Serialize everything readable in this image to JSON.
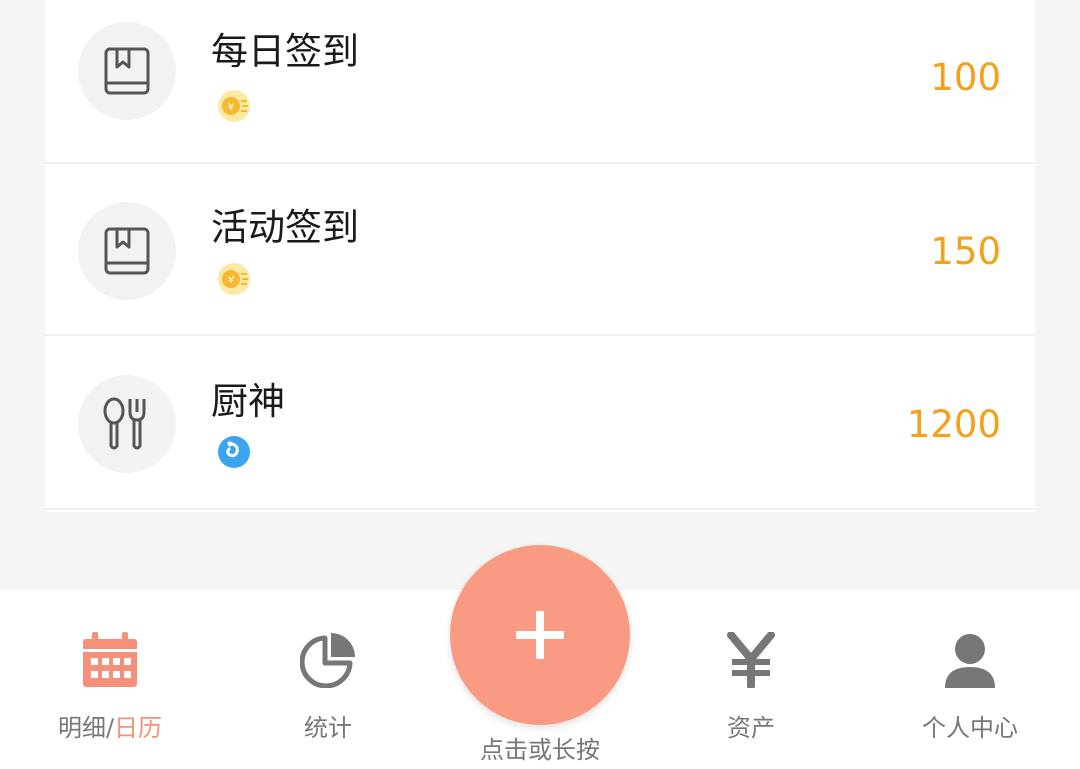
{
  "records": [
    {
      "title": "每日签到",
      "amount": "100",
      "icon": "book-icon",
      "badge": "coin-icon"
    },
    {
      "title": "活动签到",
      "amount": "150",
      "icon": "book-icon",
      "badge": "coin-icon"
    },
    {
      "title": "厨神",
      "amount": "1200",
      "icon": "utensils-icon",
      "badge": "blue-badge-icon"
    }
  ],
  "colors": {
    "amount": "#f5a01a",
    "accent": "#f99a83",
    "nav_inactive": "#777777"
  },
  "nav": {
    "detail_label_a": "明细/",
    "detail_label_b": "日历",
    "stats_label": "统计",
    "fab_label": "点击或长按",
    "assets_label": "资产",
    "profile_label": "个人中心"
  }
}
